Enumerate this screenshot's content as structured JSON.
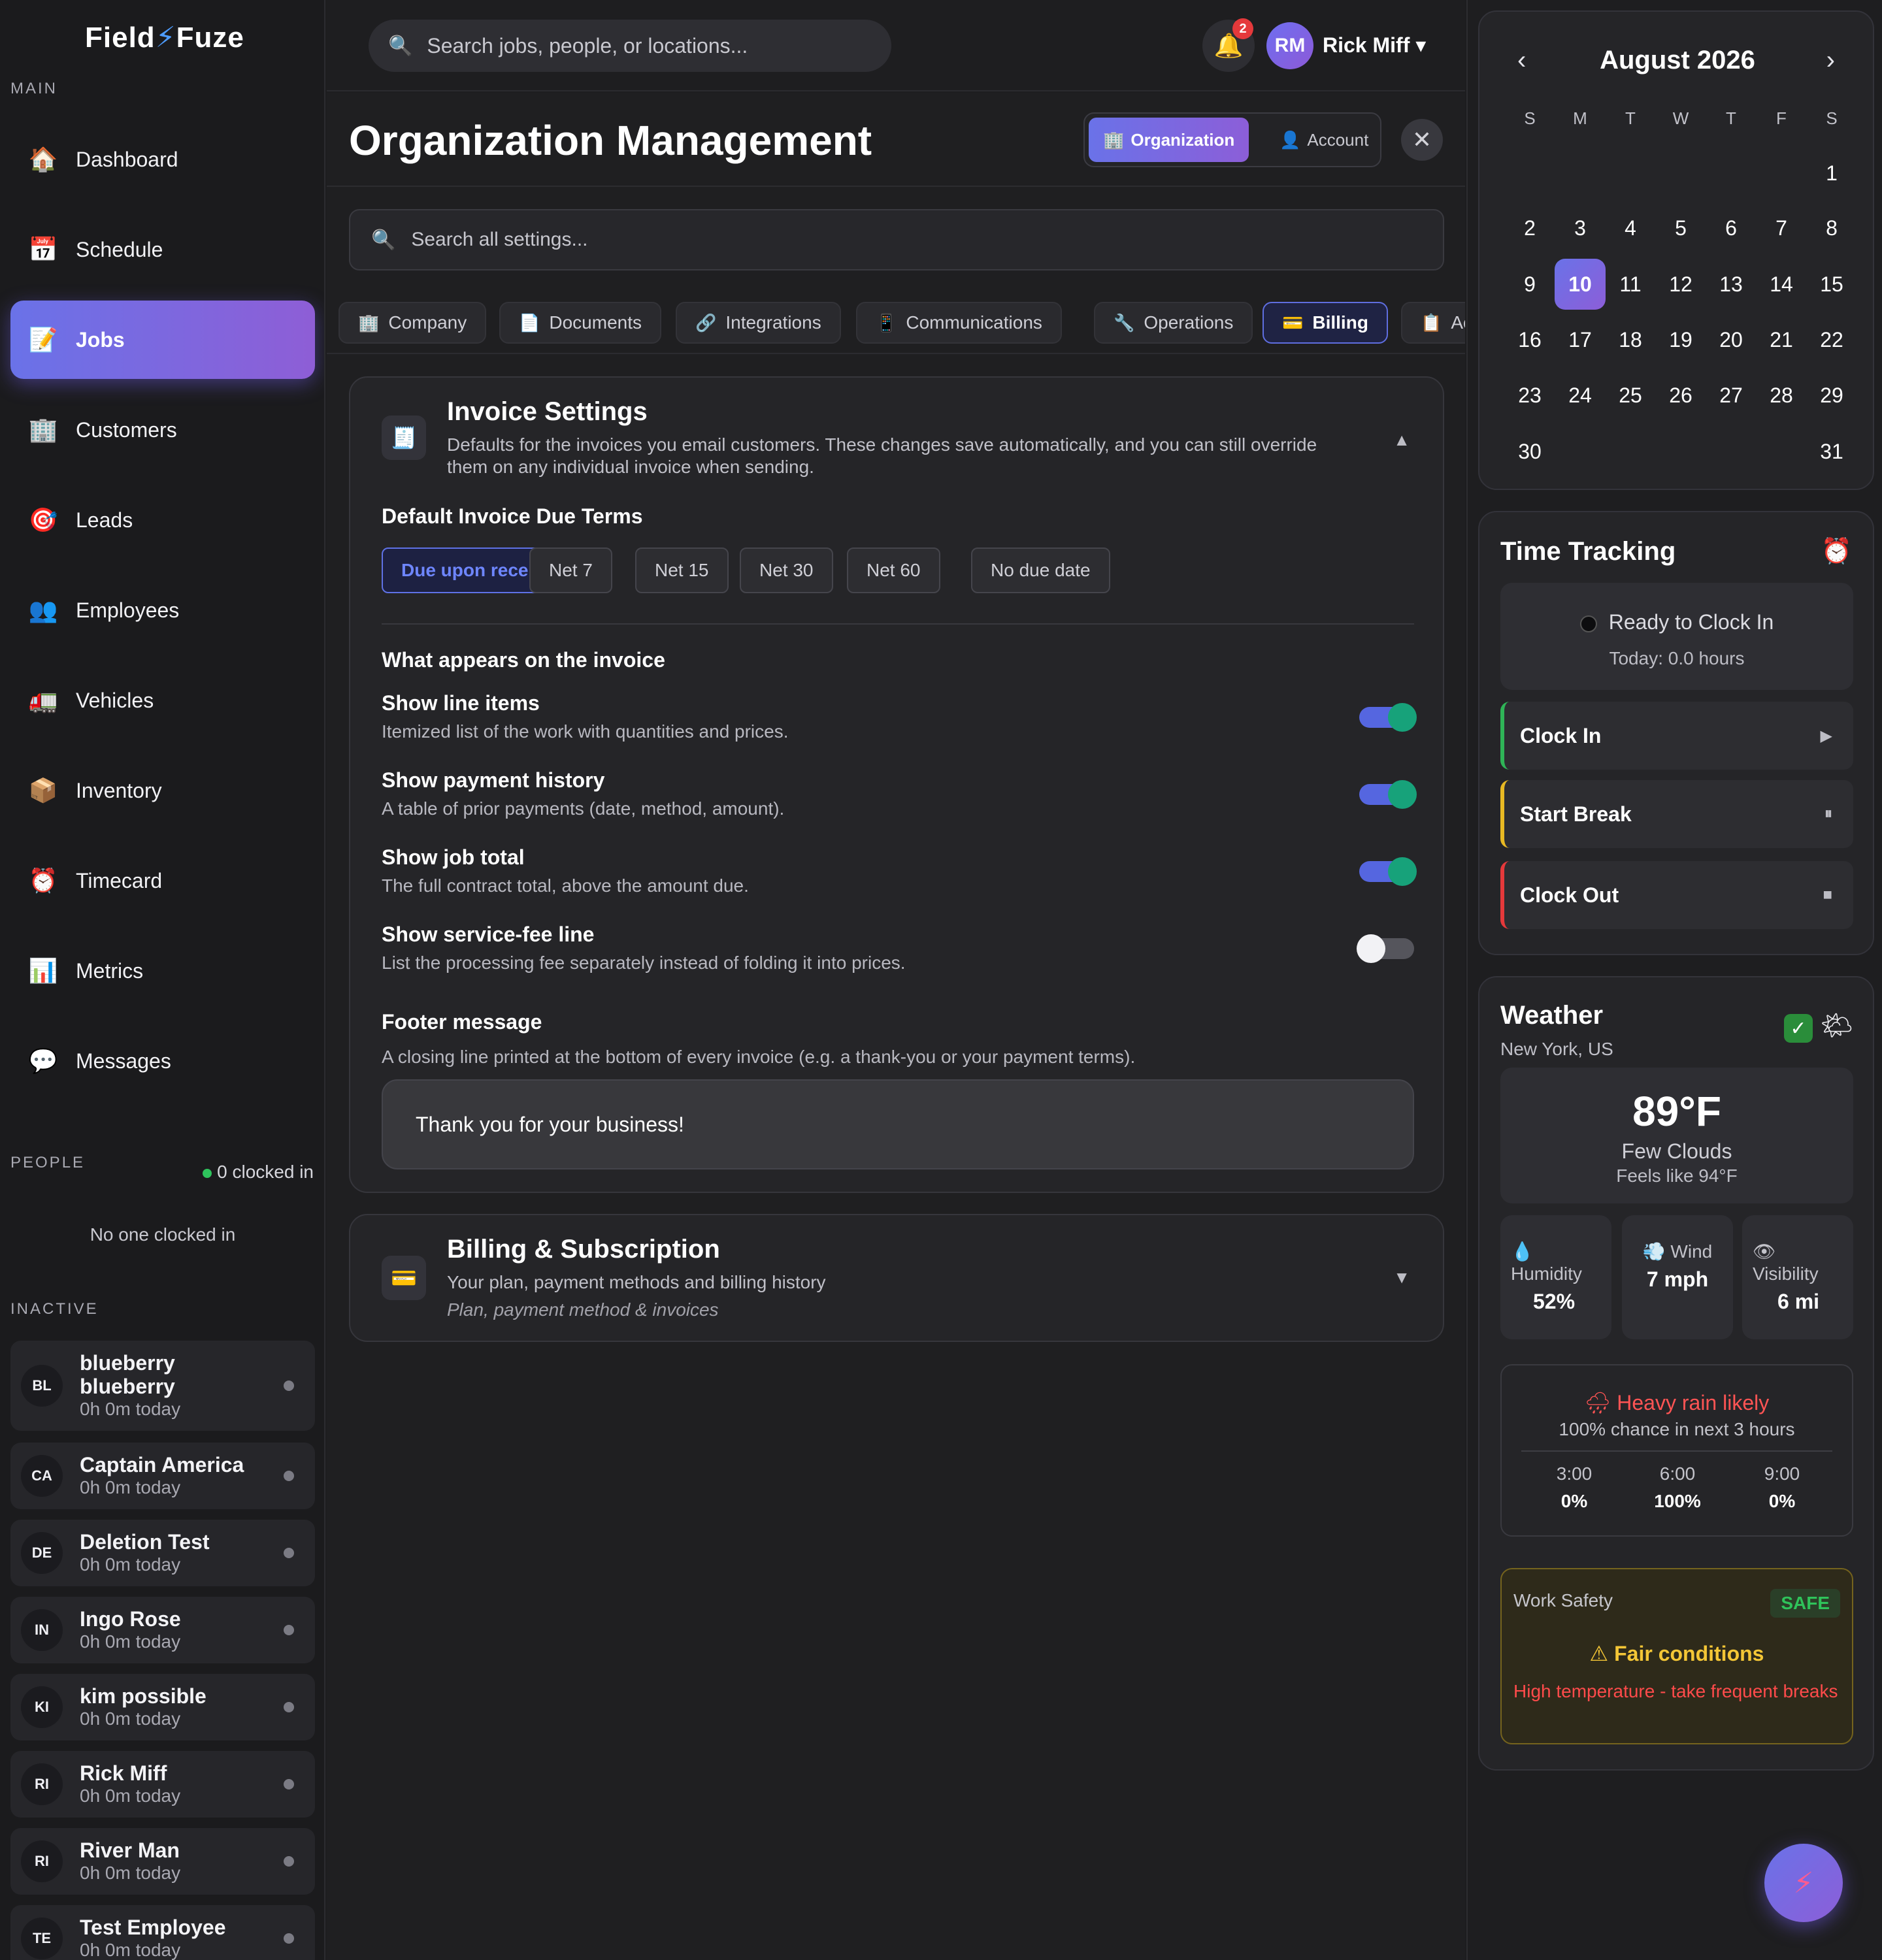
{
  "app": {
    "logo_left": "Field",
    "logo_bolt": "⚡",
    "logo_right": "Fuze"
  },
  "sidebar": {
    "main_label": "MAIN",
    "items": [
      {
        "label": "Dashboard",
        "icon": "🏠"
      },
      {
        "label": "Schedule",
        "icon": "📅"
      },
      {
        "label": "Jobs",
        "icon": "📝"
      },
      {
        "label": "Customers",
        "icon": "🏢"
      },
      {
        "label": "Leads",
        "icon": "🎯"
      },
      {
        "label": "Employees",
        "icon": "👥"
      },
      {
        "label": "Vehicles",
        "icon": "🚛"
      },
      {
        "label": "Inventory",
        "icon": "📦"
      },
      {
        "label": "Timecard",
        "icon": "⏰"
      },
      {
        "label": "Metrics",
        "icon": "📊"
      },
      {
        "label": "Messages",
        "icon": "💬"
      }
    ],
    "active_item": "Jobs",
    "people_label": "PEOPLE",
    "clocked_in": "0 clocked in",
    "no_one": "No one clocked in",
    "inactive_label": "INACTIVE",
    "people": [
      {
        "initials": "BL",
        "name": "blueberry blueberry",
        "time": "0h 0m today"
      },
      {
        "initials": "CA",
        "name": "Captain America",
        "time": "0h 0m today"
      },
      {
        "initials": "DE",
        "name": "Deletion Test",
        "time": "0h 0m today"
      },
      {
        "initials": "IN",
        "name": "Ingo Rose",
        "time": "0h 0m today"
      },
      {
        "initials": "KI",
        "name": "kim possible",
        "time": "0h 0m today"
      },
      {
        "initials": "RI",
        "name": "Rick Miff",
        "time": "0h 0m today"
      },
      {
        "initials": "RI",
        "name": "River Man",
        "time": "0h 0m today"
      },
      {
        "initials": "TE",
        "name": "Test Employee",
        "time": "0h 0m today"
      }
    ]
  },
  "topbar": {
    "search_placeholder": "Search jobs, people, or locations...",
    "notifications": "2",
    "user_initials": "RM",
    "user_name": "Rick Miff ▾"
  },
  "main": {
    "title": "Organization Management",
    "scope_tabs": [
      {
        "label": "Organization",
        "icon": "🏢"
      },
      {
        "label": "Account",
        "icon": "👤"
      }
    ],
    "close": "✕",
    "settings_search_placeholder": "Search all settings...",
    "tabs": [
      {
        "label": "Company",
        "icon": "🏢"
      },
      {
        "label": "Documents",
        "icon": "📄"
      },
      {
        "label": "Integrations",
        "icon": "🔗"
      },
      {
        "label": "Communications",
        "icon": "📱"
      },
      {
        "label": "Operations",
        "icon": "🔧"
      },
      {
        "label": "Billing",
        "icon": "💳"
      },
      {
        "label": "Activity",
        "icon": "📋"
      }
    ],
    "active_tab": "Billing",
    "invoice": {
      "icon": "🧾",
      "title": "Invoice Settings",
      "desc": "Defaults for the invoices you email customers. These changes save automatically, and you can still override them on any individual invoice when sending.",
      "caret": "▲",
      "terms_heading": "Default Invoice Due Terms",
      "terms": [
        "Due upon receipt",
        "Net 7",
        "Net 15",
        "Net 30",
        "Net 60",
        "No due date"
      ],
      "selected_term": "Due upon receipt",
      "appears_heading": "What appears on the invoice",
      "toggles": [
        {
          "title": "Show line items",
          "desc": "Itemized list of the work with quantities and prices.",
          "on": true
        },
        {
          "title": "Show payment history",
          "desc": "A table of prior payments (date, method, amount).",
          "on": true
        },
        {
          "title": "Show job total",
          "desc": "The full contract total, above the amount due.",
          "on": true
        },
        {
          "title": "Show service-fee line",
          "desc": "List the processing fee separately instead of folding it into prices.",
          "on": false
        }
      ],
      "footer_heading": "Footer message",
      "footer_desc": "A closing line printed at the bottom of every invoice (e.g. a thank-you or your payment terms).",
      "footer_value": "Thank you for your business!"
    },
    "billing": {
      "icon": "💳",
      "title": "Billing & Subscription",
      "desc": "Your plan, payment methods and billing history",
      "sub": "Plan, payment method & invoices",
      "caret": "▼"
    }
  },
  "calendar": {
    "title": "August 2026",
    "prev": "‹",
    "next": "›",
    "dow": [
      "S",
      "M",
      "T",
      "W",
      "T",
      "F",
      "S"
    ],
    "first_weekday": 6,
    "days_in_month": 31,
    "today": 10,
    "last_row": [
      "30",
      "31"
    ]
  },
  "time_tracking": {
    "title": "Time Tracking",
    "icon": "⏰",
    "status": "Ready to Clock In",
    "today": "Today: 0.0 hours",
    "buttons": [
      {
        "label": "Clock In",
        "icon": "▶",
        "color": "#2fb457"
      },
      {
        "label": "Start Break",
        "icon": "⏸",
        "color": "#e8b923"
      },
      {
        "label": "Clock Out",
        "icon": "■",
        "color": "#e5393b"
      }
    ]
  },
  "weather": {
    "title": "Weather",
    "location": "New York, US",
    "temp": "89°F",
    "condition": "Few Clouds",
    "feels": "Feels like 94°F",
    "stats": [
      {
        "icon": "💧",
        "label": "Humidity",
        "value": "52%"
      },
      {
        "icon": "💨",
        "label": "Wind",
        "value": "7 mph"
      },
      {
        "icon": "👁",
        "label": "Visibility",
        "value": "6 mi"
      }
    ],
    "rain_title": "Heavy rain likely",
    "rain_sub": "100% chance in next 3 hours",
    "forecast": [
      {
        "time": "3:00",
        "pct": "0%"
      },
      {
        "time": "6:00",
        "pct": "100%"
      },
      {
        "time": "9:00",
        "pct": "0%"
      }
    ],
    "safety_label": "Work Safety",
    "safety_badge": "SAFE",
    "safety_title": "Fair conditions",
    "safety_warn": "High temperature - take frequent breaks"
  },
  "fab_icon": "⚡"
}
